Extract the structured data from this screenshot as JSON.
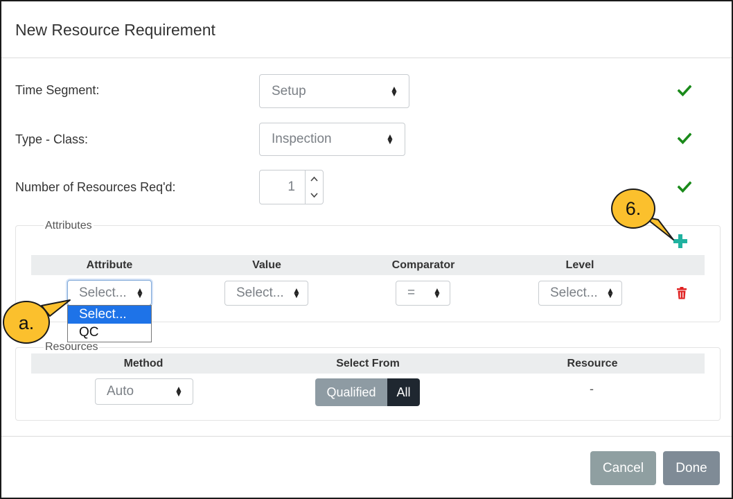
{
  "dialog": {
    "title": "New Resource Requirement"
  },
  "form": {
    "time_segment": {
      "label": "Time Segment:",
      "value": "Setup"
    },
    "type_class": {
      "label": "Type - Class:",
      "value": "Inspection"
    },
    "num_resources": {
      "label": "Number of Resources Req'd:",
      "value": "1"
    }
  },
  "attributes": {
    "legend": "Attributes",
    "columns": [
      "Attribute",
      "Value",
      "Comparator",
      "Level"
    ],
    "row": {
      "attribute": "Select...",
      "value": "Select...",
      "comparator": "=",
      "level": "Select..."
    },
    "dropdown_options": [
      "Select...",
      "QC"
    ]
  },
  "resources": {
    "legend": "Resources",
    "columns": [
      "Method",
      "Select From",
      "Resource"
    ],
    "row": {
      "method": "Auto",
      "select_from": [
        "Qualified",
        "All"
      ],
      "select_from_active": "All",
      "resource": "-"
    }
  },
  "footer": {
    "cancel_label": "Cancel",
    "done_label": "Done"
  },
  "callouts": {
    "six": "6.",
    "a": "a."
  },
  "colors": {
    "check": "#1a8a1a",
    "plus": "#20b2a0",
    "trash": "#e02020",
    "dropdown_highlight": "#1e73e8",
    "callout_fill": "#fbc02d"
  },
  "icons": [
    "check-icon",
    "plus-icon",
    "trash-icon",
    "updown-caret-icon"
  ]
}
